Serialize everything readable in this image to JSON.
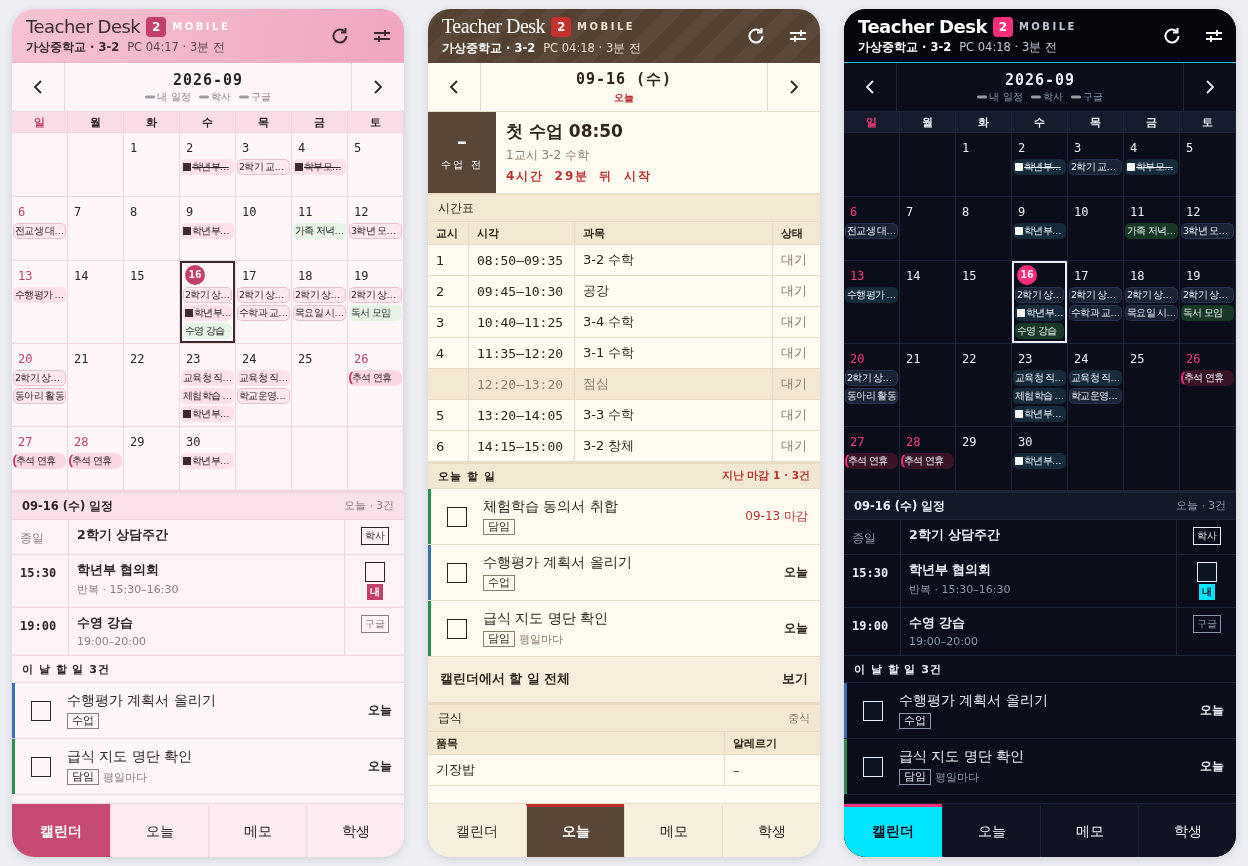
{
  "phones": [
    {
      "kind": "rose",
      "header": {
        "title": "Teacher Desk",
        "badge": "2",
        "label": "MOBILE",
        "school": "가상중학교 · 3-2",
        "sync": "PC 04:17 · 3분 전"
      },
      "nav": {
        "title": "2026-09",
        "legend": [
          "내 일정",
          "학사",
          "구글"
        ]
      },
      "sections": [
        {
          "kind": "calendar",
          "weekdays": [
            {
              "label": "일",
              "holiday": true
            },
            {
              "label": "월",
              "holiday": false
            },
            {
              "label": "화",
              "holiday": false
            },
            {
              "label": "수",
              "holiday": false
            },
            {
              "label": "목",
              "holiday": false
            },
            {
              "label": "금",
              "holiday": false
            },
            {
              "label": "토",
              "holiday": false
            }
          ],
          "weeks": [
            {
              "cells": [
                {
                  "kind": "blank"
                },
                {
                  "kind": "blank"
                },
                {
                  "kind": "day",
                  "day": "1",
                  "holiday": false,
                  "selected": false
                },
                {
                  "kind": "day",
                  "day": "2",
                  "holiday": false,
                  "selected": false,
                  "events": [
                    {
                      "kind": "mine",
                      "text": "학년부…",
                      "done": true
                    }
                  ]
                },
                {
                  "kind": "day",
                  "day": "3",
                  "holiday": false,
                  "selected": false,
                  "events": [
                    {
                      "kind": "school",
                      "text": "2학기 교…",
                      "done": false
                    }
                  ]
                },
                {
                  "kind": "day",
                  "day": "4",
                  "holiday": false,
                  "selected": false,
                  "events": [
                    {
                      "kind": "mine",
                      "text": "학부모…",
                      "done": true
                    }
                  ]
                },
                {
                  "kind": "day",
                  "day": "5",
                  "holiday": false,
                  "selected": false
                }
              ]
            },
            {
              "cells": [
                {
                  "kind": "day",
                  "day": "6",
                  "holiday": true,
                  "selected": false,
                  "events": [
                    {
                      "kind": "school",
                      "text": "전교생 대…",
                      "done": false
                    }
                  ]
                },
                {
                  "kind": "day",
                  "day": "7",
                  "holiday": false,
                  "selected": false
                },
                {
                  "kind": "day",
                  "day": "8",
                  "holiday": false,
                  "selected": false
                },
                {
                  "kind": "day",
                  "day": "9",
                  "holiday": false,
                  "selected": false,
                  "events": [
                    {
                      "kind": "mine",
                      "text": "학년부…",
                      "done": false
                    }
                  ]
                },
                {
                  "kind": "day",
                  "day": "10",
                  "holiday": false,
                  "selected": false
                },
                {
                  "kind": "day",
                  "day": "11",
                  "holiday": false,
                  "selected": false,
                  "events": [
                    {
                      "kind": "google",
                      "text": "가족 저녁…",
                      "done": false
                    }
                  ]
                },
                {
                  "kind": "day",
                  "day": "12",
                  "holiday": false,
                  "selected": false,
                  "events": [
                    {
                      "kind": "school",
                      "text": "3학년 모…",
                      "done": false
                    }
                  ]
                }
              ]
            },
            {
              "cells": [
                {
                  "kind": "day",
                  "day": "13",
                  "holiday": true,
                  "selected": false,
                  "events": [
                    {
                      "kind": "task",
                      "text": "수행평가 …",
                      "done": false
                    }
                  ]
                },
                {
                  "kind": "day",
                  "day": "14",
                  "holiday": false,
                  "selected": false
                },
                {
                  "kind": "day",
                  "day": "15",
                  "holiday": false,
                  "selected": false
                },
                {
                  "kind": "day",
                  "day": "16",
                  "holiday": false,
                  "selected": true,
                  "events": [
                    {
                      "kind": "school",
                      "text": "2학기 상…",
                      "done": false
                    },
                    {
                      "kind": "mine",
                      "text": "학년부…",
                      "done": false
                    },
                    {
                      "kind": "google",
                      "text": "수영 강습",
                      "done": false
                    }
                  ]
                },
                {
                  "kind": "day",
                  "day": "17",
                  "holiday": false,
                  "selected": false,
                  "events": [
                    {
                      "kind": "school",
                      "text": "2학기 상…",
                      "done": false
                    },
                    {
                      "kind": "school",
                      "text": "수학과 교…",
                      "done": false
                    }
                  ]
                },
                {
                  "kind": "day",
                  "day": "18",
                  "holiday": false,
                  "selected": false,
                  "events": [
                    {
                      "kind": "school",
                      "text": "2학기 상…",
                      "done": false
                    },
                    {
                      "kind": "school",
                      "text": "목요일 시…",
                      "done": false
                    }
                  ]
                },
                {
                  "kind": "day",
                  "day": "19",
                  "holiday": false,
                  "selected": false,
                  "events": [
                    {
                      "kind": "school",
                      "text": "2학기 상…",
                      "done": false
                    },
                    {
                      "kind": "google",
                      "text": "독서 모임",
                      "done": false
                    }
                  ]
                }
              ]
            },
            {
              "cells": [
                {
                  "kind": "day",
                  "day": "20",
                  "holiday": true,
                  "selected": false,
                  "events": [
                    {
                      "kind": "school",
                      "text": "2학기 상…",
                      "done": false
                    },
                    {
                      "kind": "school",
                      "text": "동아리 활동",
                      "done": false
                    }
                  ]
                },
                {
                  "kind": "day",
                  "day": "21",
                  "holiday": false,
                  "selected": false
                },
                {
                  "kind": "day",
                  "day": "22",
                  "holiday": false,
                  "selected": false
                },
                {
                  "kind": "day",
                  "day": "23",
                  "holiday": false,
                  "selected": false,
                  "events": [
                    {
                      "kind": "task",
                      "text": "교육청 직…",
                      "done": false
                    },
                    {
                      "kind": "task",
                      "text": "체험학습 …",
                      "done": false
                    },
                    {
                      "kind": "mine",
                      "text": "학년부…",
                      "done": false
                    }
                  ]
                },
                {
                  "kind": "day",
                  "day": "24",
                  "holiday": false,
                  "selected": false,
                  "events": [
                    {
                      "kind": "task",
                      "text": "교육청 직…",
                      "done": false
                    },
                    {
                      "kind": "school",
                      "text": "학교운영…",
                      "done": false
                    }
                  ]
                },
                {
                  "kind": "day",
                  "day": "25",
                  "holiday": false,
                  "selected": false
                },
                {
                  "kind": "day",
                  "day": "26",
                  "holiday": true,
                  "selected": false,
                  "events": [
                    {
                      "kind": "holiday",
                      "text": "추석 연휴",
                      "done": false
                    }
                  ]
                }
              ]
            },
            {
              "cells": [
                {
                  "kind": "day",
                  "day": "27",
                  "holiday": true,
                  "selected": false,
                  "events": [
                    {
                      "kind": "holiday",
                      "text": "추석 연휴",
                      "done": false
                    }
                  ]
                },
                {
                  "kind": "day",
                  "day": "28",
                  "holiday": true,
                  "selected": false,
                  "events": [
                    {
                      "kind": "holiday",
                      "text": "추석 연휴",
                      "done": false
                    }
                  ]
                },
                {
                  "kind": "day",
                  "day": "29",
                  "holiday": false,
                  "selected": false
                },
                {
                  "kind": "day",
                  "day": "30",
                  "holiday": false,
                  "selected": false,
                  "events": [
                    {
                      "kind": "mine",
                      "text": "학년부…",
                      "done": false
                    }
                  ]
                },
                {
                  "kind": "blank"
                },
                {
                  "kind": "blank"
                },
                {
                  "kind": "blank"
                }
              ]
            }
          ]
        },
        {
          "kind": "agenda",
          "title": "09-16 (수) 일정",
          "count": "오늘 · 3건",
          "rows": [
            {
              "kind": "school",
              "all_day": true,
              "time": "종일",
              "title": "2학기 상담주간",
              "tag": "학사"
            },
            {
              "kind": "mine",
              "all_day": false,
              "time": "15:30",
              "title": "학년부 협의회",
              "detail": "반복 · 15:30–16:30",
              "tag": "내",
              "checked": false
            },
            {
              "kind": "google",
              "all_day": false,
              "time": "19:00",
              "title": "수영 강습",
              "detail": "19:00–20:00",
              "tag": "구글"
            }
          ]
        },
        {
          "kind": "tasks",
          "title": "이 날 할 일 3건",
          "items": [
            {
              "title": "수행평가 계획서 올리기",
              "tags": [
                "수업"
              ],
              "due": "오늘",
              "overdue": false,
              "checked": false,
              "color": "#3a6db5"
            },
            {
              "title": "급식 지도 명단 확인",
              "tags": [
                "담임"
              ],
              "note": "평일마다",
              "due": "오늘",
              "overdue": false,
              "checked": false,
              "color": "#2e8b57"
            }
          ]
        }
      ],
      "tabs": [
        {
          "label": "캘린더",
          "selected": true
        },
        {
          "label": "오늘",
          "selected": false
        },
        {
          "label": "메모",
          "selected": false
        },
        {
          "label": "학생",
          "selected": false
        }
      ]
    },
    {
      "kind": "cocoa",
      "header": {
        "title": "Teacher Desk",
        "badge": "2",
        "label": "MOBILE",
        "school": "가상중학교 · 3-2",
        "sync": "PC 04:18 · 3분 전"
      },
      "nav": {
        "title": "09-16 (수)",
        "subtitle": "오늘"
      },
      "sections": [
        {
          "kind": "next_class",
          "status_icon": "–",
          "status": "수업 전",
          "title": "첫 수업 08:50",
          "detail": "1교시 3-2 수학",
          "countdown": "4시간 29분 뒤 시작"
        },
        {
          "kind": "timetable",
          "title": "시간표",
          "columns": [
            "교시",
            "시각",
            "과목",
            "상태"
          ],
          "rows": [
            {
              "kind": "class",
              "period": "1",
              "time": "08:50–09:35",
              "subject": "3-2 수학",
              "status": "대기"
            },
            {
              "kind": "class",
              "period": "2",
              "time": "09:45–10:30",
              "subject": "공강",
              "status": "대기"
            },
            {
              "kind": "class",
              "period": "3",
              "time": "10:40–11:25",
              "subject": "3-4 수학",
              "status": "대기"
            },
            {
              "kind": "class",
              "period": "4",
              "time": "11:35–12:20",
              "subject": "3-1 수학",
              "status": "대기"
            },
            {
              "kind": "break",
              "time": "12:20–13:20",
              "subject": "점심",
              "status": "대기"
            },
            {
              "kind": "class",
              "period": "5",
              "time": "13:20–14:05",
              "subject": "3-3 수학",
              "status": "대기"
            },
            {
              "kind": "class",
              "period": "6",
              "time": "14:15–15:00",
              "subject": "3-2 창체",
              "status": "대기"
            }
          ]
        },
        {
          "kind": "tasks",
          "title": "오늘 할 일",
          "summary": "지난 마감 1 · 3건",
          "items": [
            {
              "title": "체험학습 동의서 취합",
              "tags": [
                "담임"
              ],
              "due": "09-13 마감",
              "overdue": true,
              "checked": false,
              "color": "#2e8b57"
            },
            {
              "title": "수행평가 계획서 올리기",
              "tags": [
                "수업"
              ],
              "due": "오늘",
              "overdue": false,
              "checked": false,
              "color": "#3a6db5"
            },
            {
              "title": "급식 지도 명단 확인",
              "tags": [
                "담임"
              ],
              "note": "평일마다",
              "due": "오늘",
              "overdue": false,
              "checked": false,
              "color": "#2e8b57"
            }
          ]
        },
        {
          "kind": "link",
          "text": "캘린더에서 할 일 전체",
          "action": "보기"
        },
        {
          "kind": "meal",
          "title": "급식",
          "note": "중식",
          "columns": [
            "품목",
            "알레르기"
          ],
          "rows": [
            {
              "item": "기장밥",
              "allergy": "–"
            }
          ]
        }
      ],
      "tabs": [
        {
          "label": "캘린더",
          "selected": false
        },
        {
          "label": "오늘",
          "selected": true
        },
        {
          "label": "메모",
          "selected": false
        },
        {
          "label": "학생",
          "selected": false
        }
      ]
    },
    {
      "kind": "neon",
      "header": {
        "title": "Teacher Desk",
        "badge": "2",
        "label": "MOBILE",
        "school": "가상중학교 · 3-2",
        "sync": "PC 04:18 · 3분 전"
      },
      "nav": {
        "title": "2026-09",
        "legend": [
          "내 일정",
          "학사",
          "구글"
        ]
      },
      "sections": [
        {
          "kind": "calendar",
          "weekdays": [
            {
              "label": "일",
              "holiday": true
            },
            {
              "label": "월",
              "holiday": false
            },
            {
              "label": "화",
              "holiday": false
            },
            {
              "label": "수",
              "holiday": false
            },
            {
              "label": "목",
              "holiday": false
            },
            {
              "label": "금",
              "holiday": false
            },
            {
              "label": "토",
              "holiday": false
            }
          ],
          "weeks": [
            {
              "cells": [
                {
                  "kind": "blank"
                },
                {
                  "kind": "blank"
                },
                {
                  "kind": "day",
                  "day": "1",
                  "holiday": false,
                  "selected": false
                },
                {
                  "kind": "day",
                  "day": "2",
                  "holiday": false,
                  "selected": false,
                  "events": [
                    {
                      "kind": "mine",
                      "text": "학년부…",
                      "done": true
                    }
                  ]
                },
                {
                  "kind": "day",
                  "day": "3",
                  "holiday": false,
                  "selected": false,
                  "events": [
                    {
                      "kind": "school",
                      "text": "2학기 교…",
                      "done": false
                    }
                  ]
                },
                {
                  "kind": "day",
                  "day": "4",
                  "holiday": false,
                  "selected": false,
                  "events": [
                    {
                      "kind": "mine",
                      "text": "학부모…",
                      "done": true
                    }
                  ]
                },
                {
                  "kind": "day",
                  "day": "5",
                  "holiday": false,
                  "selected": false
                }
              ]
            },
            {
              "cells": [
                {
                  "kind": "day",
                  "day": "6",
                  "holiday": true,
                  "selected": false,
                  "events": [
                    {
                      "kind": "school",
                      "text": "전교생 대…",
                      "done": false
                    }
                  ]
                },
                {
                  "kind": "day",
                  "day": "7",
                  "holiday": false,
                  "selected": false
                },
                {
                  "kind": "day",
                  "day": "8",
                  "holiday": false,
                  "selected": false
                },
                {
                  "kind": "day",
                  "day": "9",
                  "holiday": false,
                  "selected": false,
                  "events": [
                    {
                      "kind": "mine",
                      "text": "학년부…",
                      "done": false
                    }
                  ]
                },
                {
                  "kind": "day",
                  "day": "10",
                  "holiday": false,
                  "selected": false
                },
                {
                  "kind": "day",
                  "day": "11",
                  "holiday": false,
                  "selected": false,
                  "events": [
                    {
                      "kind": "google",
                      "text": "가족 저녁…",
                      "done": false
                    }
                  ]
                },
                {
                  "kind": "day",
                  "day": "12",
                  "holiday": false,
                  "selected": false,
                  "events": [
                    {
                      "kind": "school",
                      "text": "3학년 모…",
                      "done": false
                    }
                  ]
                }
              ]
            },
            {
              "cells": [
                {
                  "kind": "day",
                  "day": "13",
                  "holiday": true,
                  "selected": false,
                  "events": [
                    {
                      "kind": "task",
                      "text": "수행평가 …",
                      "done": false
                    }
                  ]
                },
                {
                  "kind": "day",
                  "day": "14",
                  "holiday": false,
                  "selected": false
                },
                {
                  "kind": "day",
                  "day": "15",
                  "holiday": false,
                  "selected": false
                },
                {
                  "kind": "day",
                  "day": "16",
                  "holiday": false,
                  "selected": true,
                  "events": [
                    {
                      "kind": "school",
                      "text": "2학기 상…",
                      "done": false
                    },
                    {
                      "kind": "mine",
                      "text": "학년부…",
                      "done": false
                    },
                    {
                      "kind": "google",
                      "text": "수영 강습",
                      "done": false
                    }
                  ]
                },
                {
                  "kind": "day",
                  "day": "17",
                  "holiday": false,
                  "selected": false,
                  "events": [
                    {
                      "kind": "school",
                      "text": "2학기 상…",
                      "done": false
                    },
                    {
                      "kind": "school",
                      "text": "수학과 교…",
                      "done": false
                    }
                  ]
                },
                {
                  "kind": "day",
                  "day": "18",
                  "holiday": false,
                  "selected": false,
                  "events": [
                    {
                      "kind": "school",
                      "text": "2학기 상…",
                      "done": false
                    },
                    {
                      "kind": "school",
                      "text": "목요일 시…",
                      "done": false
                    }
                  ]
                },
                {
                  "kind": "day",
                  "day": "19",
                  "holiday": false,
                  "selected": false,
                  "events": [
                    {
                      "kind": "school",
                      "text": "2학기 상…",
                      "done": false
                    },
                    {
                      "kind": "google",
                      "text": "독서 모임",
                      "done": false
                    }
                  ]
                }
              ]
            },
            {
              "cells": [
                {
                  "kind": "day",
                  "day": "20",
                  "holiday": true,
                  "selected": false,
                  "events": [
                    {
                      "kind": "school",
                      "text": "2학기 상…",
                      "done": false
                    },
                    {
                      "kind": "school",
                      "text": "동아리 활동",
                      "done": false
                    }
                  ]
                },
                {
                  "kind": "day",
                  "day": "21",
                  "holiday": false,
                  "selected": false
                },
                {
                  "kind": "day",
                  "day": "22",
                  "holiday": false,
                  "selected": false
                },
                {
                  "kind": "day",
                  "day": "23",
                  "holiday": false,
                  "selected": false,
                  "events": [
                    {
                      "kind": "task",
                      "text": "교육청 직…",
                      "done": false
                    },
                    {
                      "kind": "task",
                      "text": "체험학습 …",
                      "done": false
                    },
                    {
                      "kind": "mine",
                      "text": "학년부…",
                      "done": false
                    }
                  ]
                },
                {
                  "kind": "day",
                  "day": "24",
                  "holiday": false,
                  "selected": false,
                  "events": [
                    {
                      "kind": "task",
                      "text": "교육청 직…",
                      "done": false
                    },
                    {
                      "kind": "school",
                      "text": "학교운영…",
                      "done": false
                    }
                  ]
                },
                {
                  "kind": "day",
                  "day": "25",
                  "holiday": false,
                  "selected": false
                },
                {
                  "kind": "day",
                  "day": "26",
                  "holiday": true,
                  "selected": false,
                  "events": [
                    {
                      "kind": "holiday",
                      "text": "추석 연휴",
                      "done": false
                    }
                  ]
                }
              ]
            },
            {
              "cells": [
                {
                  "kind": "day",
                  "day": "27",
                  "holiday": true,
                  "selected": false,
                  "events": [
                    {
                      "kind": "holiday",
                      "text": "추석 연휴",
                      "done": false
                    }
                  ]
                },
                {
                  "kind": "day",
                  "day": "28",
                  "holiday": true,
                  "selected": false,
                  "events": [
                    {
                      "kind": "holiday",
                      "text": "추석 연휴",
                      "done": false
                    }
                  ]
                },
                {
                  "kind": "day",
                  "day": "29",
                  "holiday": false,
                  "selected": false
                },
                {
                  "kind": "day",
                  "day": "30",
                  "holiday": false,
                  "selected": false,
                  "events": [
                    {
                      "kind": "mine",
                      "text": "학년부…",
                      "done": false
                    }
                  ]
                },
                {
                  "kind": "blank"
                },
                {
                  "kind": "blank"
                },
                {
                  "kind": "blank"
                }
              ]
            }
          ]
        },
        {
          "kind": "agenda",
          "title": "09-16 (수) 일정",
          "count": "오늘 · 3건",
          "rows": [
            {
              "kind": "school",
              "all_day": true,
              "time": "종일",
              "title": "2학기 상담주간",
              "tag": "학사"
            },
            {
              "kind": "mine",
              "all_day": false,
              "time": "15:30",
              "title": "학년부 협의회",
              "detail": "반복 · 15:30–16:30",
              "tag": "내",
              "checked": false
            },
            {
              "kind": "google",
              "all_day": false,
              "time": "19:00",
              "title": "수영 강습",
              "detail": "19:00–20:00",
              "tag": "구글"
            }
          ]
        },
        {
          "kind": "tasks",
          "title": "이 날 할 일 3건",
          "items": [
            {
              "title": "수행평가 계획서 올리기",
              "tags": [
                "수업"
              ],
              "due": "오늘",
              "overdue": false,
              "checked": false,
              "color": "#3a6db5"
            },
            {
              "title": "급식 지도 명단 확인",
              "tags": [
                "담임"
              ],
              "note": "평일마다",
              "due": "오늘",
              "overdue": false,
              "checked": false,
              "color": "#2e8b57"
            }
          ]
        }
      ],
      "tabs": [
        {
          "label": "캘린더",
          "selected": true
        },
        {
          "label": "오늘",
          "selected": false
        },
        {
          "label": "메모",
          "selected": false
        },
        {
          "label": "학생",
          "selected": false
        }
      ]
    }
  ]
}
